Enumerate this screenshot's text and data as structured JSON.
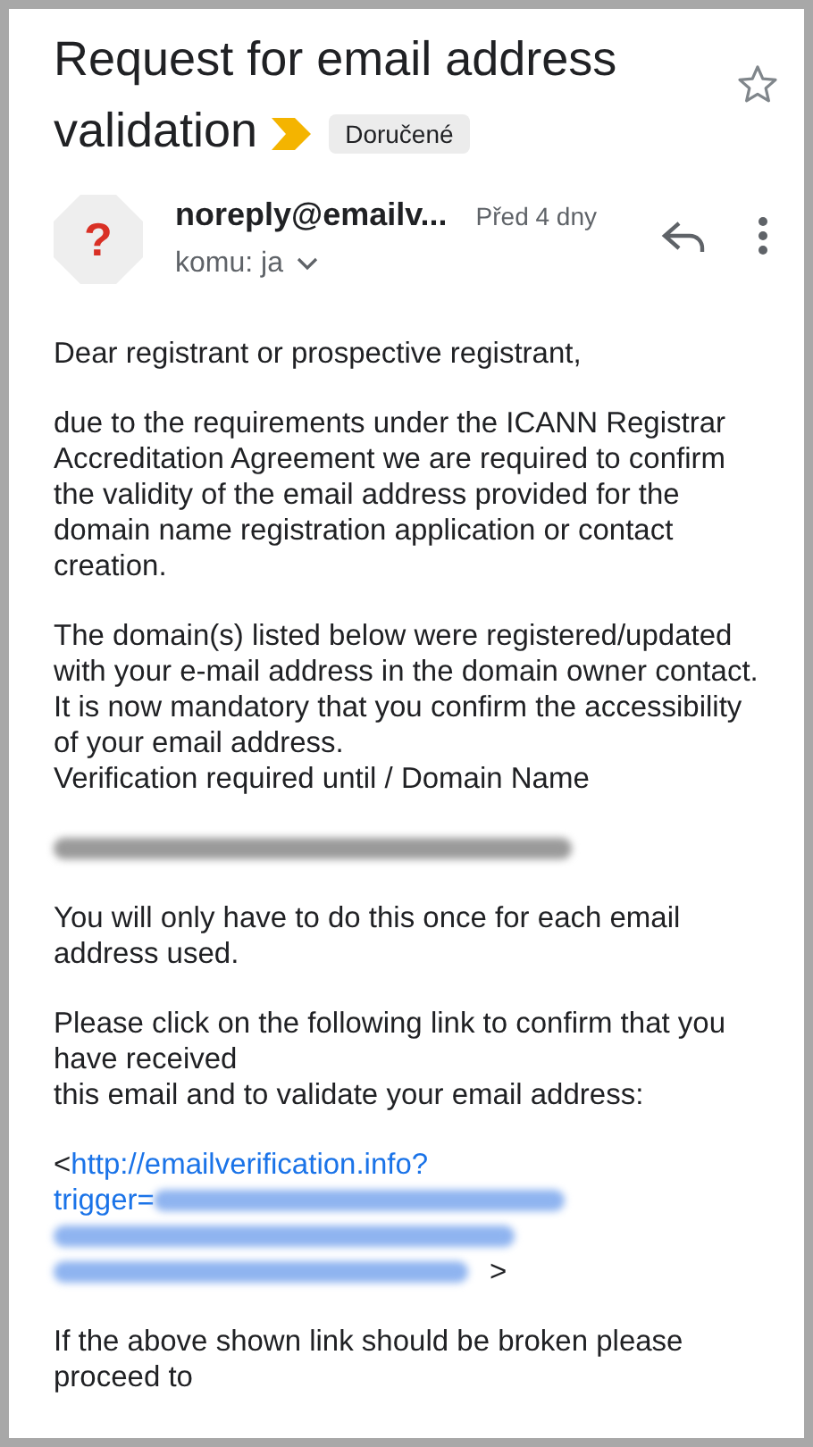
{
  "subject": {
    "title_lines": [
      "Request for email address",
      "validation"
    ],
    "label": "Doručené",
    "starred": false
  },
  "message": {
    "sender": "noreply@emailv...",
    "time": "Před 4 dny",
    "recipient": "komu: ja",
    "avatar": "?"
  },
  "body": [
    {
      "kind": "text",
      "text": "Dear registrant or prospective registrant,"
    },
    {
      "kind": "text",
      "text": "due to the requirements under the ICANN Registrar Accreditation Agreement we are required to confirm the validity of the email address provided for the domain name registration application or contact creation."
    },
    {
      "kind": "text",
      "text": "The domain(s) listed below were registered/updated with your e-mail address in the domain owner contact. It is now mandatory that you confirm the accessibility of your email address.\nVerification required until / Domain Name"
    },
    {
      "kind": "redacted"
    },
    {
      "kind": "text",
      "text": "You will only have to do this once for each email address used."
    },
    {
      "kind": "text",
      "text": "Please click on the following link to confirm that you have received\nthis email and to validate your email address:"
    },
    {
      "kind": "link",
      "before": "<",
      "link_lines": [
        "http://emailverification.info?",
        "trigger="
      ],
      "after": ">"
    },
    {
      "kind": "text",
      "text": "If the above shown link should be broken please proceed to"
    }
  ]
}
